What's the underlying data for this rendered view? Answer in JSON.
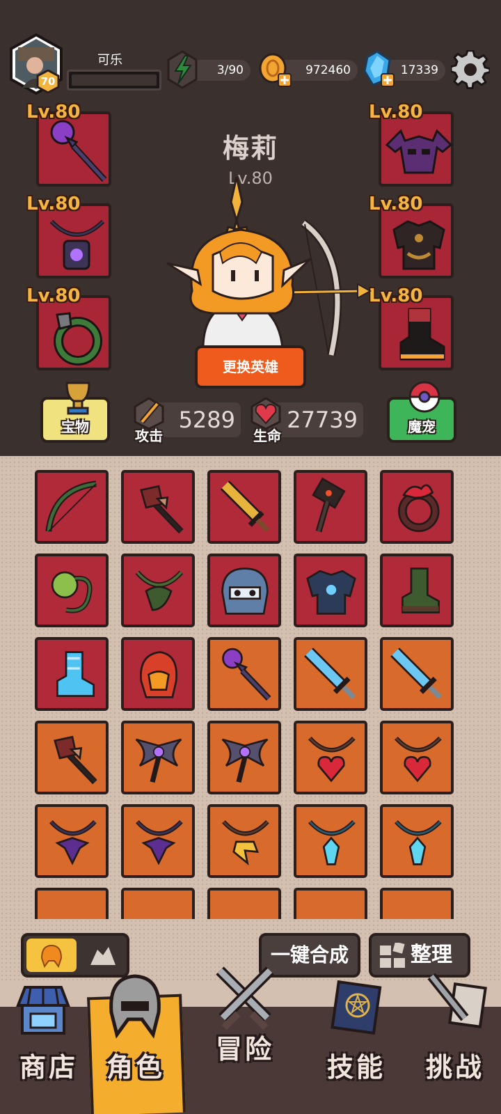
{
  "player": {
    "name": "可乐",
    "level": "70"
  },
  "resources": {
    "energy": "3/90",
    "coins": "972460",
    "gems": "17339"
  },
  "hero": {
    "name": "梅莉",
    "level": "Lv.80",
    "change_label": "更换英雄"
  },
  "equipment": {
    "left": [
      {
        "level": "Lv.80",
        "item": "staff-icon"
      },
      {
        "level": "Lv.80",
        "item": "lantern-necklace-icon"
      },
      {
        "level": "Lv.80",
        "item": "vine-ring-icon"
      }
    ],
    "right": [
      {
        "level": "Lv.80",
        "item": "bat-helmet-icon"
      },
      {
        "level": "Lv.80",
        "item": "armor-icon"
      },
      {
        "level": "Lv.80",
        "item": "boots-icon"
      }
    ]
  },
  "stats": {
    "attack_label": "攻击",
    "attack_value": "5289",
    "hp_label": "生命",
    "hp_value": "27739"
  },
  "side_buttons": {
    "treasure": "宝物",
    "pet": "魔宠"
  },
  "inventory": [
    {
      "item": "bow-icon",
      "rarity": "red"
    },
    {
      "item": "torch-staff-icon",
      "rarity": "red"
    },
    {
      "item": "golden-sword-icon",
      "rarity": "red"
    },
    {
      "item": "hammer-icon",
      "rarity": "red"
    },
    {
      "item": "flame-ring-icon",
      "rarity": "red"
    },
    {
      "item": "thorn-ring-icon",
      "rarity": "red"
    },
    {
      "item": "vine-necklace-icon",
      "rarity": "red"
    },
    {
      "item": "frost-helmet-icon",
      "rarity": "red"
    },
    {
      "item": "frost-armor-icon",
      "rarity": "red"
    },
    {
      "item": "leaf-boots-icon",
      "rarity": "red"
    },
    {
      "item": "ice-boots-icon",
      "rarity": "red"
    },
    {
      "item": "fire-helmet-icon",
      "rarity": "red"
    },
    {
      "item": "staff-icon",
      "rarity": "orange"
    },
    {
      "item": "ice-sword-icon",
      "rarity": "orange"
    },
    {
      "item": "ice-sword-icon",
      "rarity": "orange"
    },
    {
      "item": "torch-staff-icon",
      "rarity": "orange"
    },
    {
      "item": "eye-axe-icon",
      "rarity": "orange"
    },
    {
      "item": "eye-axe-icon",
      "rarity": "orange"
    },
    {
      "item": "heart-necklace-icon",
      "rarity": "orange"
    },
    {
      "item": "heart-necklace-icon",
      "rarity": "orange"
    },
    {
      "item": "dark-necklace-icon",
      "rarity": "orange"
    },
    {
      "item": "dark-necklace-icon",
      "rarity": "orange"
    },
    {
      "item": "gold-necklace-icon",
      "rarity": "orange"
    },
    {
      "item": "crystal-necklace-icon",
      "rarity": "orange"
    },
    {
      "item": "crystal-necklace-icon",
      "rarity": "orange"
    }
  ],
  "toolbar": {
    "merge_all": "一键合成",
    "sort": "整理"
  },
  "nav": [
    {
      "label": "商店",
      "icon": "shop-icon"
    },
    {
      "label": "角色",
      "icon": "helmet-icon"
    },
    {
      "label": "冒险",
      "icon": "crossed-swords-icon"
    },
    {
      "label": "技能",
      "icon": "spellbook-icon"
    },
    {
      "label": "挑战",
      "icon": "sword-scroll-icon"
    }
  ],
  "colors": {
    "rarity_red": "#b02a3a",
    "rarity_orange": "#d86a2c",
    "level_text": "#f4b641",
    "active_tab": "#f4ad2c"
  }
}
